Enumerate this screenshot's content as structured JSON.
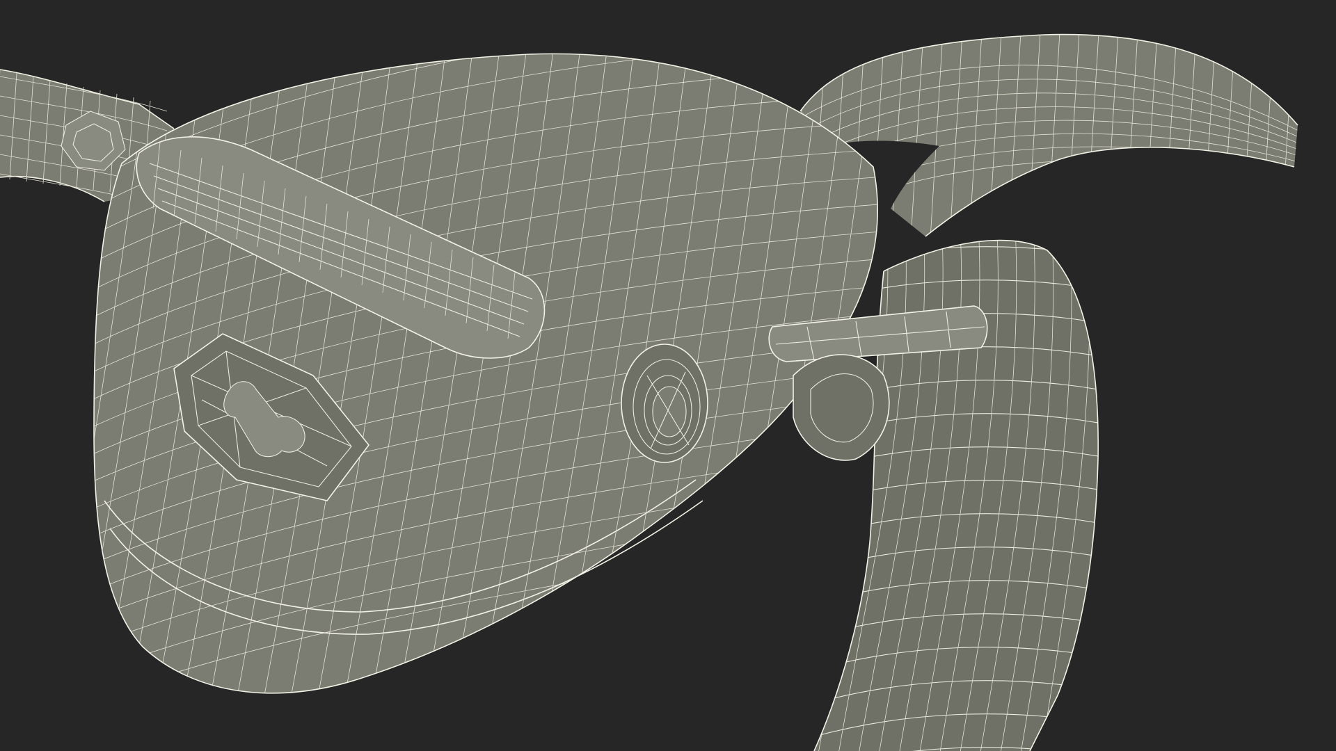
{
  "scene": {
    "subject": "wireframe-3d-model",
    "background_color": "#262626",
    "mesh_fill_color": "#7c7d72",
    "wire_color": "#ecebe0"
  }
}
